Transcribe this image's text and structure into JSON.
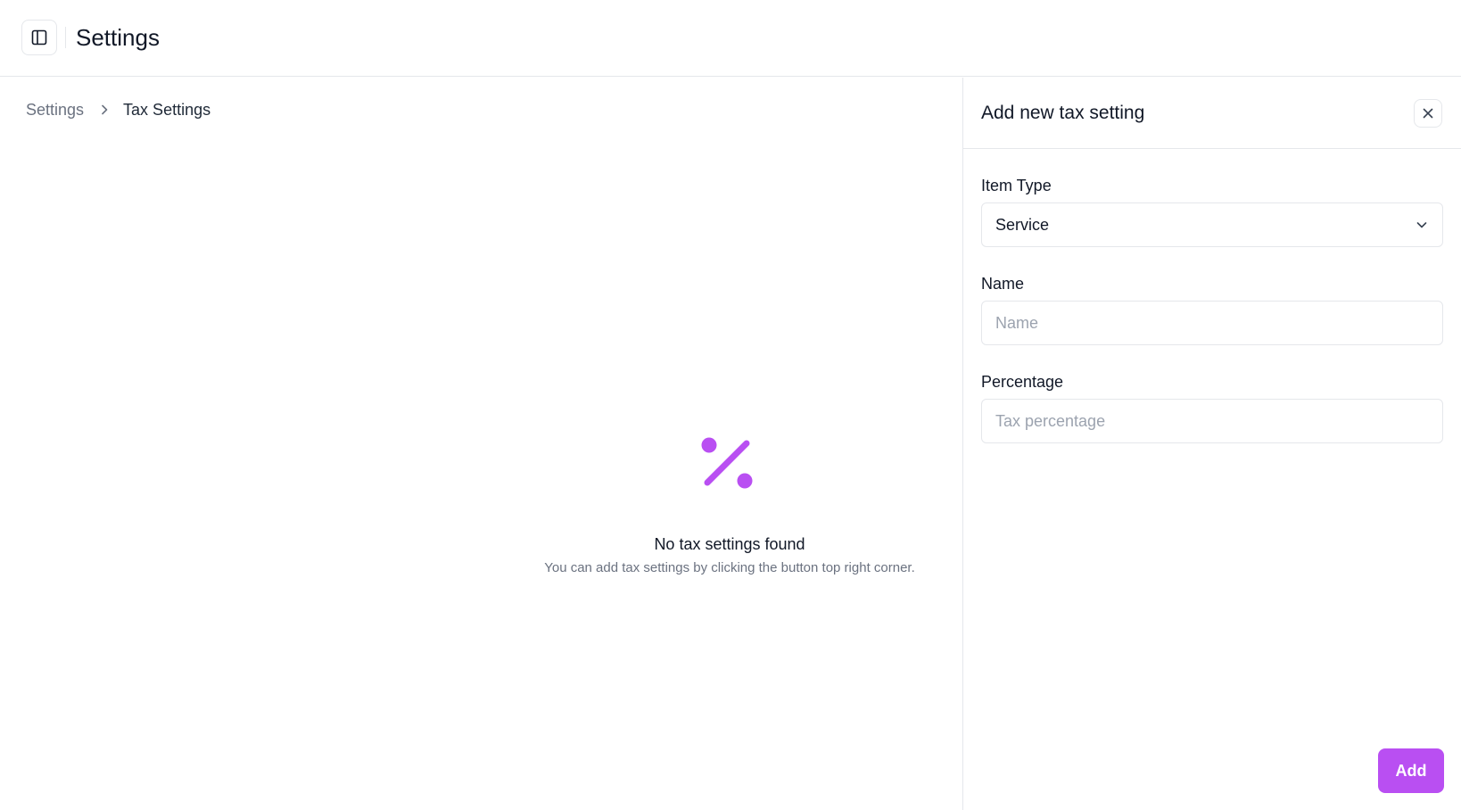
{
  "header": {
    "title": "Settings",
    "sidebar_toggle_icon": "sidebar-panel-icon"
  },
  "breadcrumb": {
    "items": [
      "Settings",
      "Tax Settings"
    ],
    "separator_icon": "chevron-right-icon"
  },
  "empty_state": {
    "icon": "percent-icon",
    "icon_color": "#b94ff2",
    "title": "No tax settings found",
    "subtitle": "You can add tax settings by clicking the button top right corner."
  },
  "panel": {
    "title": "Add new tax setting",
    "close_icon": "close-icon",
    "fields": {
      "item_type": {
        "label": "Item Type",
        "value": "Service"
      },
      "name": {
        "label": "Name",
        "placeholder": "Name",
        "value": ""
      },
      "percentage": {
        "label": "Percentage",
        "placeholder": "Tax percentage",
        "value": ""
      }
    },
    "submit_label": "Add",
    "accent_color": "#b94ff2"
  }
}
